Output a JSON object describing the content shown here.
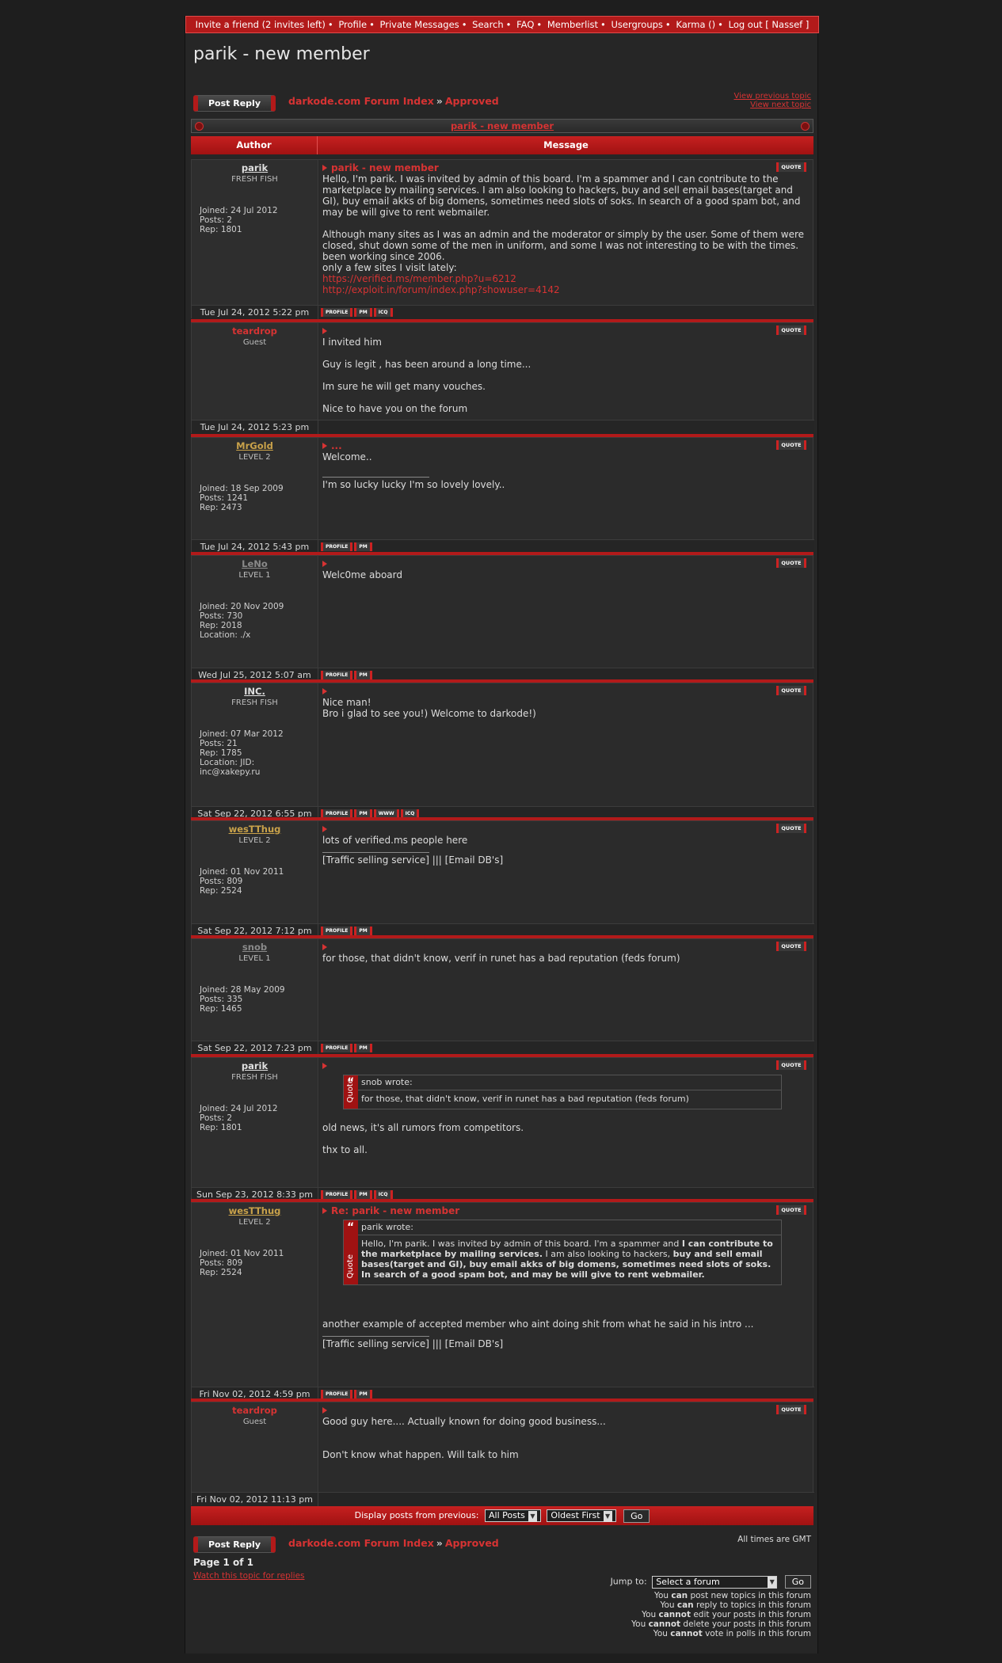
{
  "nav": {
    "items": [
      "Invite a friend (2 invites left)",
      "Profile",
      "Private Messages",
      "Search",
      "FAQ",
      "Memberlist",
      "Usergroups",
      "Karma ()",
      "Log out [ Nassef ]"
    ]
  },
  "page_title": "parik - new member",
  "post_reply_label": "Post Reply",
  "breadcrumb": {
    "index": "darkode.com Forum Index",
    "sep": "»",
    "forum": "Approved"
  },
  "view_prev": "View previous topic",
  "view_next": "View next topic",
  "topic_bar_title": "parik - new member",
  "table_header": {
    "author": "Author",
    "message": "Message"
  },
  "posts": [
    {
      "author": "parik",
      "rank": "FRESH FISH",
      "info": [
        "Joined: 24 Jul 2012",
        "Posts: 2",
        "Rep: 1801"
      ],
      "subject": "parik - new member",
      "body": [
        "Hello, I'm parik. I was invited by admin of this board. I'm a spammer and I can contribute to the marketplace by mailing services. I am also looking to hackers, buy and sell email bases(target and GI), buy email akks of big domens, sometimes need slots of soks. In search of a good spam bot, and may be will give to rent webmailer.",
        "",
        "Although many sites as I was an admin and the moderator or simply by the user. Some of them were closed, shut down some of the men in uniform, and some I was not interesting to be with the times. been working since 2006.",
        "only a few sites I visit lately:"
      ],
      "links": [
        "https://verified.ms/member.php?u=6212",
        "http://exploit.in/forum/index.php?showuser=4142"
      ],
      "date": "Tue Jul 24, 2012 5:22 pm",
      "buttons": [
        "PROFILE",
        "PM",
        "ICQ"
      ]
    },
    {
      "author": "teardrop",
      "rank": "Guest",
      "info": [],
      "subject": "",
      "body": [
        "I invited him",
        "",
        "Guy is legit , has been around a long time...",
        "",
        "Im sure he will get many vouches.",
        "",
        "Nice to have you on the forum"
      ],
      "date": "Tue Jul 24, 2012 5:23 pm",
      "buttons": []
    },
    {
      "author": "MrGold",
      "rank": "LEVEL 2",
      "info": [
        "Joined: 18 Sep 2009",
        "Posts: 1241",
        "Rep: 2473"
      ],
      "subject": "...",
      "body": [
        "Welcome.."
      ],
      "sig": "I'm so lucky lucky I'm so lovely lovely..",
      "date": "Tue Jul 24, 2012 5:43 pm",
      "buttons": [
        "PROFILE",
        "PM"
      ]
    },
    {
      "author": "LeNo",
      "rank": "LEVEL 1",
      "info": [
        "Joined: 20 Nov 2009",
        "Posts: 730",
        "Rep: 2018",
        "Location: ./x"
      ],
      "subject": "",
      "body": [
        "Welc0me aboard"
      ],
      "date": "Wed Jul 25, 2012 5:07 am",
      "buttons": [
        "PROFILE",
        "PM"
      ]
    },
    {
      "author": "INC.",
      "rank": "FRESH FISH",
      "info": [
        "Joined: 07 Mar 2012",
        "Posts: 21",
        "Rep: 1785",
        "Location: JID: inc@xakepy.ru"
      ],
      "subject": "",
      "body": [
        "Nice man!",
        "Bro i glad to see you!) Welcome to darkode!)"
      ],
      "date": "Sat Sep 22, 2012 6:55 pm",
      "buttons": [
        "PROFILE",
        "PM",
        "WWW",
        "ICQ"
      ]
    },
    {
      "author": "wesTThug",
      "rank": "LEVEL 2",
      "info": [
        "Joined: 01 Nov 2011",
        "Posts: 809",
        "Rep: 2524"
      ],
      "subject": "",
      "body": [
        "lots of verified.ms people here"
      ],
      "sig": "[Traffic selling service] ||| [Email DB's]",
      "date": "Sat Sep 22, 2012 7:12 pm",
      "buttons": [
        "PROFILE",
        "PM"
      ]
    },
    {
      "author": "snob",
      "rank": "LEVEL 1",
      "info": [
        "Joined: 28 May 2009",
        "Posts: 335",
        "Rep: 1465"
      ],
      "subject": "",
      "body": [
        "for those, that didn't know, verif in runet has a bad reputation (feds forum)"
      ],
      "date": "Sat Sep 22, 2012 7:23 pm",
      "buttons": [
        "PROFILE",
        "PM"
      ]
    },
    {
      "author": "parik",
      "rank": "FRESH FISH",
      "info": [
        "Joined: 24 Jul 2012",
        "Posts: 2",
        "Rep: 1801"
      ],
      "subject": "",
      "quote": {
        "head": "snob wrote:",
        "body": "for those, that didn't know, verif in runet has a bad reputation (feds forum)",
        "label": "Quote"
      },
      "body": [
        "old news, it's all rumors from competitors.",
        "",
        "thx to all."
      ],
      "date": "Sun Sep 23, 2012 8:33 pm",
      "buttons": [
        "PROFILE",
        "PM",
        "ICQ"
      ]
    },
    {
      "author": "wesTThug",
      "rank": "LEVEL 2",
      "info": [
        "Joined: 01 Nov 2011",
        "Posts: 809",
        "Rep: 2524"
      ],
      "subject": "Re: parik - new member",
      "quote": {
        "head": "parik wrote:",
        "label": "Quote",
        "pre": "Hello, I'm parik. I was invited by admin of this board. I'm a spammer and ",
        "b1": "I can contribute to the marketplace by mailing services.",
        "mid": " I am also looking to hackers, ",
        "b2": "buy and sell email bases(target and GI), buy email akks of big domens, sometimes need slots of soks. In search of a good spam bot, and may be will give to rent webmailer."
      },
      "body": [
        "another example of accepted member who aint doing shit from what he said in his intro ..."
      ],
      "sig": "[Traffic selling service] ||| [Email DB's]",
      "date": "Fri Nov 02, 2012 4:59 pm",
      "buttons": [
        "PROFILE",
        "PM"
      ]
    },
    {
      "author": "teardrop",
      "rank": "Guest",
      "info": [],
      "subject": "",
      "body": [
        "Good guy here.... Actually known for doing good business...",
        "",
        "",
        "Don't know what happen. Will talk to him"
      ],
      "date": "Fri Nov 02, 2012 11:13 pm",
      "buttons": []
    }
  ],
  "quote_button": "QUOTE",
  "display_bar": {
    "label": "Display posts from previous:",
    "posts_sel": "All Posts",
    "order_sel": "Oldest First",
    "go": "Go"
  },
  "gmt_note": "All times are GMT",
  "page_of": "Page 1 of 1",
  "watch_link": "Watch this topic for replies",
  "jump": {
    "label": "Jump to:",
    "select": "Select a forum",
    "go": "Go"
  },
  "perms": [
    [
      "You ",
      "can",
      " post new topics in this forum"
    ],
    [
      "You ",
      "can",
      " reply to topics in this forum"
    ],
    [
      "You ",
      "cannot",
      " edit your posts in this forum"
    ],
    [
      "You ",
      "cannot",
      " delete your posts in this forum"
    ],
    [
      "You ",
      "cannot",
      " vote in polls in this forum"
    ]
  ],
  "colors": {
    "accent": "#b21a1a",
    "link": "#d63333",
    "gold": "#c9a24a",
    "gray_name": "#8a8a8a",
    "bg": "#262626"
  }
}
